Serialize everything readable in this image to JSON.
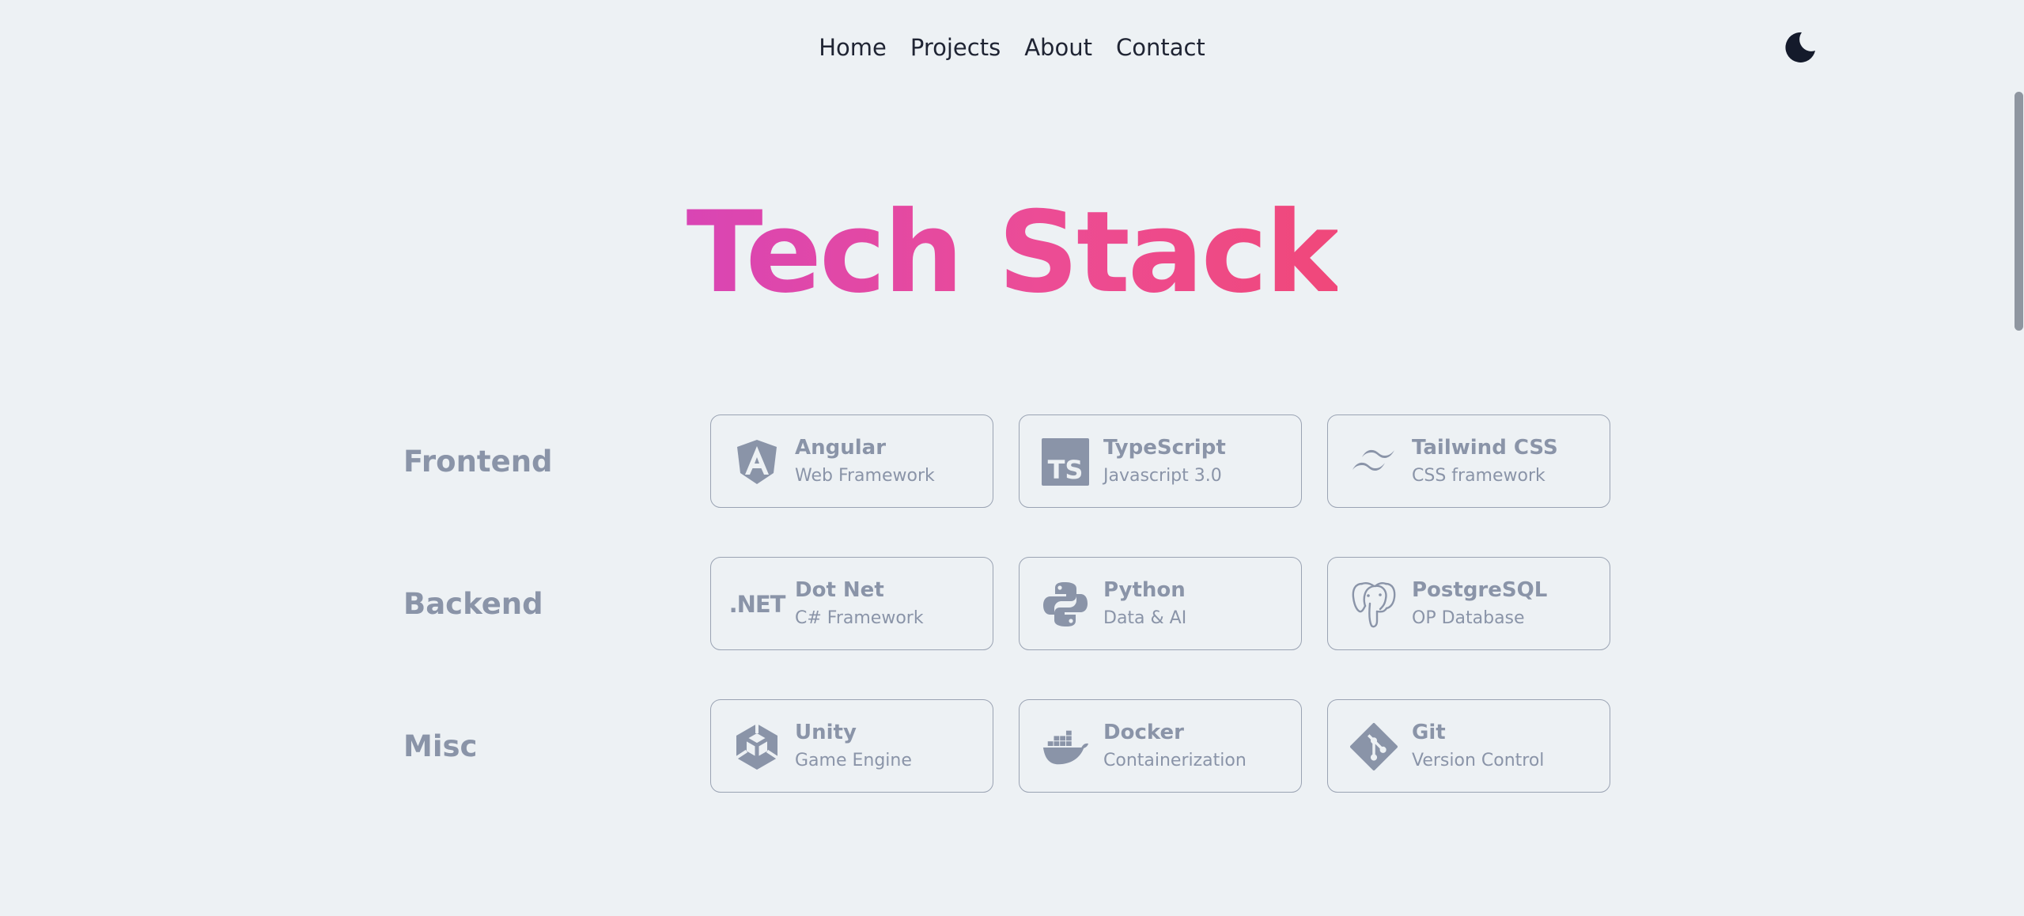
{
  "nav": {
    "links": [
      "Home",
      "Projects",
      "About",
      "Contact"
    ],
    "theme_icon": "moon-icon"
  },
  "title": "Tech Stack",
  "colors": {
    "background": "#edf1f4",
    "title_gradient": [
      "#d945b4",
      "#ec4c95",
      "#f0487a"
    ],
    "muted": "#8a94a8",
    "nav_text": "#1f2433"
  },
  "stack": [
    {
      "category": "Frontend",
      "items": [
        {
          "name": "Angular",
          "desc": "Web Framework",
          "icon": "angular-icon"
        },
        {
          "name": "TypeScript",
          "desc": "Javascript 3.0",
          "icon": "typescript-icon"
        },
        {
          "name": "Tailwind CSS",
          "desc": "CSS framework",
          "icon": "tailwind-icon"
        }
      ]
    },
    {
      "category": "Backend",
      "items": [
        {
          "name": "Dot Net",
          "desc": "C# Framework",
          "icon": "dotnet-icon",
          "icon_text": ".NET"
        },
        {
          "name": "Python",
          "desc": "Data & AI",
          "icon": "python-icon"
        },
        {
          "name": "PostgreSQL",
          "desc": "OP Database",
          "icon": "postgresql-icon"
        }
      ]
    },
    {
      "category": "Misc",
      "items": [
        {
          "name": "Unity",
          "desc": "Game Engine",
          "icon": "unity-icon"
        },
        {
          "name": "Docker",
          "desc": "Containerization",
          "icon": "docker-icon"
        },
        {
          "name": "Git",
          "desc": "Version Control",
          "icon": "git-icon"
        }
      ]
    }
  ]
}
